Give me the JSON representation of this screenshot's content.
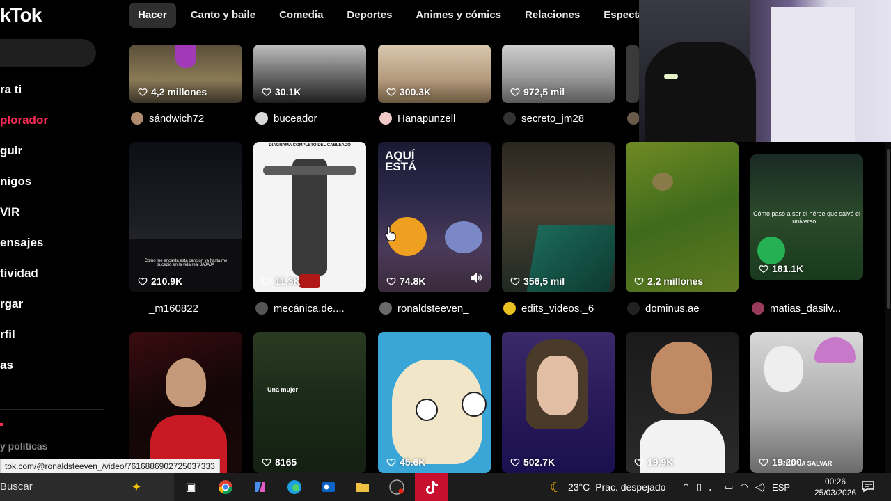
{
  "sidebar": {
    "logo": "kTok",
    "items": [
      {
        "label": "ra ti",
        "active": false
      },
      {
        "label": "plorador",
        "active": true
      },
      {
        "label": "guir",
        "active": false
      },
      {
        "label": "nigos",
        "active": false
      },
      {
        "label": "VIR",
        "active": false
      },
      {
        "label": "ensajes",
        "active": false
      },
      {
        "label": "tividad",
        "active": false
      },
      {
        "label": "rgar",
        "active": false
      },
      {
        "label": "rfil",
        "active": false
      },
      {
        "label": "as",
        "active": false
      }
    ],
    "policies": "y políticas"
  },
  "tabs": [
    "Hacer",
    "Canto y baile",
    "Comedia",
    "Deportes",
    "Animes y cómics",
    "Relaciones",
    "Espectáculos"
  ],
  "videos": {
    "row1": [
      {
        "likes": "4,2 millones",
        "author": "sándwich72"
      },
      {
        "likes": "30.1K",
        "author": "buceador"
      },
      {
        "likes": "300.3K",
        "author": "Hanapunzell"
      },
      {
        "likes": "972,5 mil",
        "author": "secreto_jm28"
      }
    ],
    "row2": [
      {
        "likes": "210.9K",
        "author": "_m160822",
        "overlay": "Como me encanta esta cancion ya hasta me sucedió en la vida real JAJAJA"
      },
      {
        "likes": "11.3K",
        "author": "mecánica.de....",
        "overlay": "DIAGRAMA COMPLETO DEL CABLEADO"
      },
      {
        "likes": "74.8K",
        "author": "ronaldsteeven_",
        "overlay": "AQUÍ ESTÁ"
      },
      {
        "likes": "356,5 mil",
        "author": "edits_videos._6"
      },
      {
        "likes": "2,2 millones",
        "author": "dominus.ae"
      },
      {
        "likes": "181.1K",
        "author": "matias_dasilv...",
        "overlay": "Cómo pasó a ser el héroe que salvó el universo..."
      }
    ],
    "row3": [
      {
        "likes": "",
        "author": ""
      },
      {
        "likes": "8165",
        "author": "",
        "overlay": "Una mujer"
      },
      {
        "likes": "45.6K",
        "author": ""
      },
      {
        "likes": "502.7K",
        "author": ""
      },
      {
        "likes": "19.9K",
        "author": ""
      },
      {
        "likes": "19.200",
        "author": "",
        "overlay": "PODRÍA SALVAR"
      }
    ]
  },
  "status_url": "tok.com/@ronaldsteeven_/video/7616886902725037333",
  "taskbar": {
    "search": "Buscar",
    "weather_temp": "23°C",
    "weather_text": "Prac. despejado",
    "language": "ESP",
    "time": "00:26",
    "date": "25/03/2026"
  },
  "colors": {
    "accent": "#fe2c55",
    "background": "#000000"
  }
}
